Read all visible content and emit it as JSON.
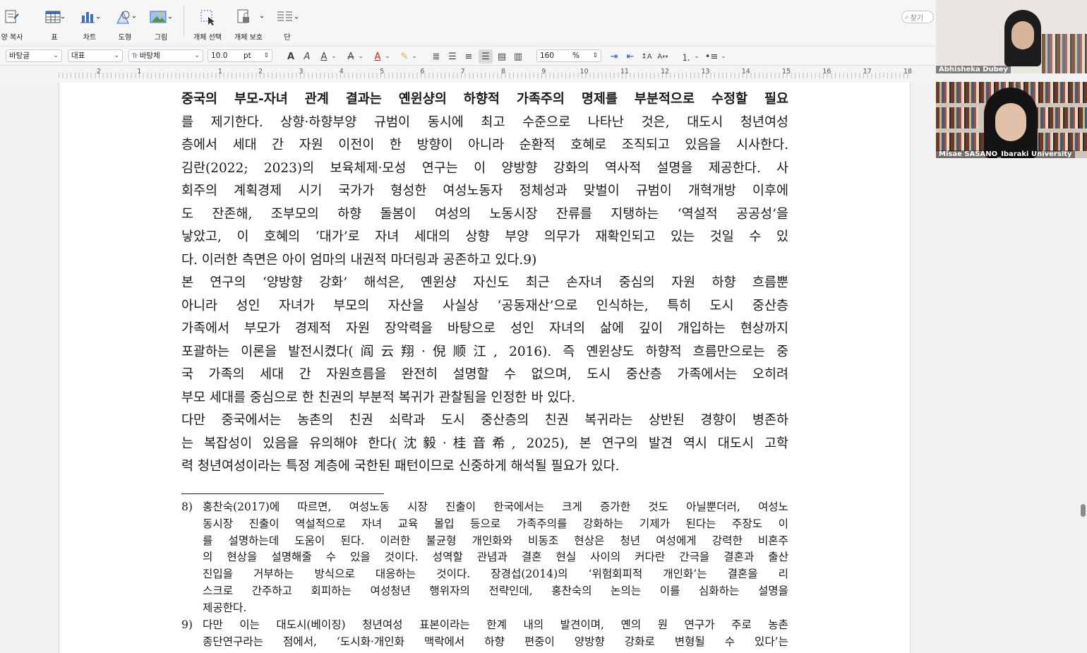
{
  "ribbon": {
    "items": [
      {
        "label": "양 복사",
        "icon": "format-painter-icon"
      },
      {
        "label": "표",
        "icon": "table-icon"
      },
      {
        "label": "차트",
        "icon": "chart-icon"
      },
      {
        "label": "도형",
        "icon": "shape-icon"
      },
      {
        "label": "그림",
        "icon": "picture-icon"
      },
      {
        "label": "개체 선택",
        "icon": "object-select-icon"
      },
      {
        "label": "개체 보호",
        "icon": "object-protect-icon"
      },
      {
        "label": "단",
        "icon": "columns-icon"
      }
    ],
    "find_label": "찾기"
  },
  "format_bar": {
    "style": "바탕글",
    "language": "대표",
    "font": "바탕체",
    "font_size": "10.0",
    "size_unit": "pt",
    "zoom_value": "160",
    "zoom_unit": "%"
  },
  "ruler": {
    "numbers": [
      "2",
      "1",
      "",
      "1",
      "2",
      "3",
      "4",
      "5",
      "6",
      "7",
      "8",
      "9",
      "10",
      "11",
      "12",
      "13",
      "14",
      "15",
      "16",
      "17",
      "18"
    ]
  },
  "document": {
    "body_lines": [
      [
        "중국의 부모-자녀 관계 결과는 옌윈샹의 하향적 가족주의 명제를 부분적으로 수정할 필요",
        "를 제기한다. 상향·하향부양 규범이 동시에 최고 수준으로 나타난 것은, 대도시 청년여성",
        "층에서 세대 간 자원 이전이 한 방향이 아니라 순환적 호혜로 조직되고 있음을 시사한다.",
        "김란(2022; 2023)의 보육체제·모성 연구는 이 양방향 강화의 역사적 설명을 제공한다. 사",
        "회주의 계획경제 시기 국가가 형성한 여성노동자 정체성과 맞벌이 규범이 개혁개방 이후에",
        "도 잔존해, 조부모의 하향 돌봄이 여성의 노동시장 잔류를 지탱하는 ‘역설적 공공성’을",
        "낳았고, 이 호혜의 ‘대가’로 자녀 세대의 상향 부양 의무가 재확인되고 있는 것일 수 있",
        "다. 이러한 측면은 아이 엄마의 내권적 마더링과 공존하고 있다.9)"
      ],
      [
        "  본 연구의 ‘양방향 강화’ 해석은, 옌윈샹 자신도 최근 손자녀 중심의 자원 하향 흐름뿐",
        "아니라 성인 자녀가 부모의 자산을 사실상 ‘공동재산’으로 인식하는, 특히 도시 중산층",
        "가족에서 부모가 경제적 자원 장악력을 바탕으로 성인 자녀의 삶에 깊이 개입하는 현상까지",
        "포괄하는 이론을 발전시켰다(阎云翔·倪顺江, 2016). 즉 옌윈샹도 하향적 흐름만으로는 중",
        "국 가족의 세대 간 자원흐름을 완전히 설명할 수 없으며, 도시 중산층 가족에서는 오히려",
        "부모 세대를 중심으로 한 친권의 부분적 복귀가 관찰됨을 인정한 바 있다."
      ],
      [
        "  다만 중국에서는 농촌의 친권 쇠락과 도시 중산층의 친권 복귀라는 상반된 경향이 병존하",
        "는 복잡성이 있음을 유의해야 한다(沈毅·桂音希, 2025), 본 연구의 발견 역시 대도시 고학",
        "력 청년여성이라는 특정 계층에 국한된 패턴이므로 신중하게 해석될 필요가 있다."
      ]
    ],
    "footnotes": [
      {
        "num": "8)",
        "lines": [
          "홍찬숙(2017)에 따르면, 여성노동 시장 진출이 한국에서는 크게 증가한 것도 아닐뿐더러, 여성노",
          "동시장 진출이 역설적으로 자녀 교육 몰입 등으로 가족주의를 강화하는 기제가 된다는 주장도 이",
          "를 설명하는데 도움이 된다. 이러한 불균형 개인화와 비동조 현상은 청년 여성에게 강력한 비혼주",
          "의 현상을 설명해줄 수 있을 것이다. 성역할 관념과 결혼 현실 사이의 커다란 간극을 결혼과 출산",
          "진입을 거부하는 방식으로 대응하는 것이다. 장경섭(2014)의 ‘위험회피적 개인화’는 결혼을 리",
          "스크로 간주하고 회피하는 여성청년 행위자의 전략인데, 홍찬숙의 논의는 이를 심화하는 설명을",
          "제공한다."
        ]
      },
      {
        "num": "9)",
        "lines": [
          "다만 이는 대도시(베이징) 청년여성 표본이라는 한계 내의 발견이며, 옌의 원 연구가 주로 농촌",
          "종단연구라는 점에서, ‘도시화·개인화 맥락에서 하향 편중이 양방향 강화로 변형될 수 있다’는"
        ]
      }
    ]
  },
  "video": {
    "participants": [
      {
        "name": "Abhisheka Dubey"
      },
      {
        "name": "Misae SASANO_Ibaraki University"
      }
    ]
  }
}
